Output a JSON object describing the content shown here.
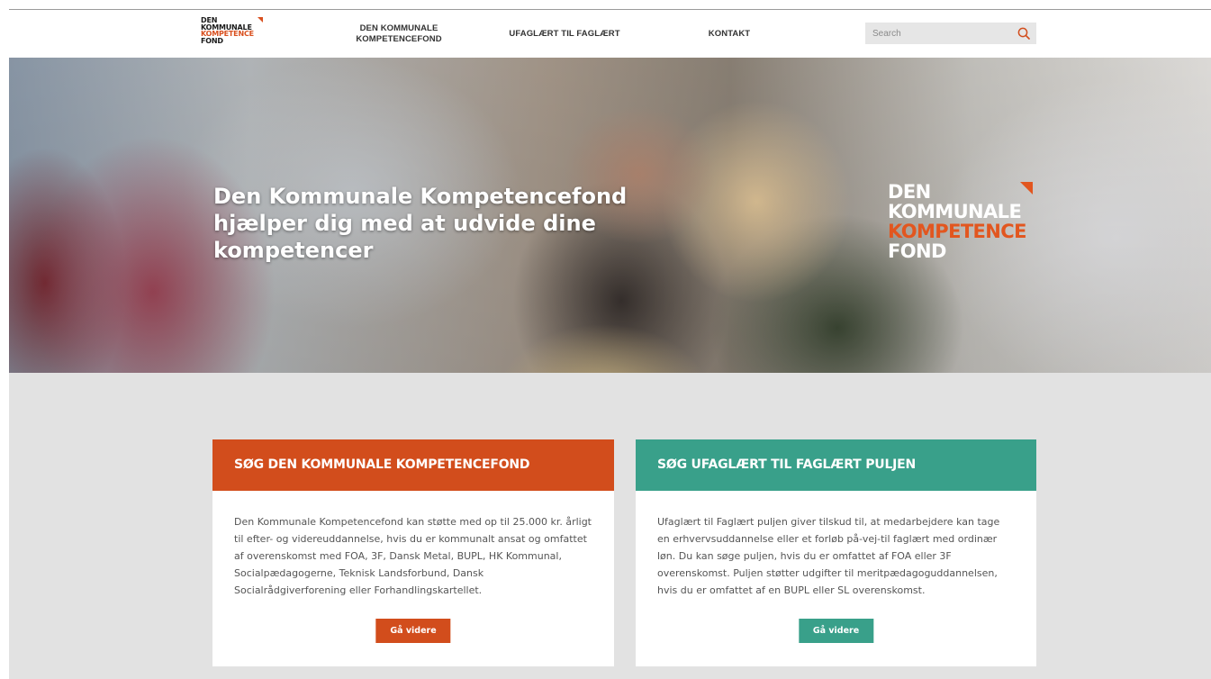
{
  "header": {
    "logo_lines": [
      "DEN",
      "KOMMUNALE",
      "KOMPETENCE",
      "FOND"
    ],
    "nav": [
      {
        "label_line1": "DEN KOMMUNALE",
        "label_line2": "KOMPETENCEFOND"
      },
      {
        "label": "UFAGLÆRT TIL FAGLÆRT"
      },
      {
        "label": "KONTAKT"
      }
    ],
    "search_placeholder": "Search",
    "search_icon": "search-icon"
  },
  "hero": {
    "title_lines": [
      "Den Kommunale Kompetencefond",
      "hjælper dig med at udvide dine",
      "kompetencer"
    ],
    "logo_lines": [
      "DEN",
      "KOMMUNALE",
      "KOMPETENCE",
      "FOND"
    ]
  },
  "cards": [
    {
      "title": "SØG DEN KOMMUNALE KOMPETENCEFOND",
      "body": "Den Kommunale Kompetencefond kan støtte med op til 25.000 kr. årligt til efter- og videreuddannelse, hvis du er kommunalt ansat og omfattet af overenskomst med FOA, 3F, Dansk Metal, BUPL, HK Kommunal, Socialpædagogerne, Teknisk Landsforbund, Dansk Socialrådgiverforening eller Forhandlingskartellet.",
      "button": "Gå videre",
      "accent": "#d24d1c"
    },
    {
      "title": "SØG UFAGLÆRT TIL FAGLÆRT PULJEN",
      "body": "Ufaglært til Faglært puljen giver tilskud til, at medarbejdere kan tage en erhvervsuddannelse eller et forløb på-vej-til faglært med ordinær løn. Du kan søge puljen, hvis du er omfattet af FOA eller 3F overenskomst. Puljen støtter udgifter til meritpædagoguddannelsen, hvis du er omfattet af en BUPL eller SL overenskomst.",
      "button": "Gå videre",
      "accent": "#39a08a"
    }
  ],
  "colors": {
    "brand_orange": "#d24d1c",
    "brand_teal": "#39a08a",
    "background_gray": "#e2e2e2"
  }
}
